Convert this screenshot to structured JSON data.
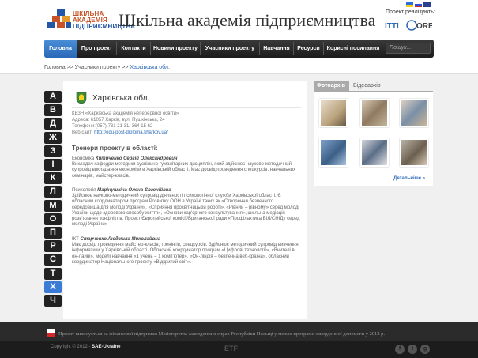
{
  "header": {
    "logo_lines": [
      "ШКІЛЬНА",
      "АКАДЕМІЯ",
      "ПІДПРИЄМНИЦТВА"
    ],
    "site_title": "Шкільна академія підприємництва",
    "project_label": "Проект реалізують:",
    "partner_logos": [
      "ITTI",
      "ORE"
    ],
    "colors": {
      "logo_orange": "#c8532a",
      "logo_blue": "#2356a5"
    }
  },
  "nav": {
    "items": [
      "Головна",
      "Про проект",
      "Контакти",
      "Новини проекту",
      "Учасники проекту",
      "Навчання",
      "Ресурси",
      "Корисні посилання"
    ],
    "active_index": 0,
    "search_placeholder": "Пошук..."
  },
  "breadcrumb": {
    "home": "Головна",
    "sep": ">>",
    "section": "Учасники проекту",
    "current": "Харківська обл."
  },
  "alphabet": [
    "А",
    "В",
    "Д",
    "Ж",
    "З",
    "І",
    "К",
    "Л",
    "М",
    "О",
    "П",
    "Р",
    "С",
    "Т",
    "Х",
    "Ч"
  ],
  "alphabet_active": "Х",
  "region": {
    "title": "Харківська обл.",
    "org": "КВЗН «Харківська академія неперервної освіти»",
    "address": "Адреса: 61057 Харків, вул. Пушкінська, 24",
    "phones": "Телефони:(057) 731 21 31, 364 15 62",
    "website_label": "Веб сайт:",
    "website": "http://edu-post-diploma.kharkov.ua/"
  },
  "trainers_heading": "Тренери проекту в області:",
  "trainers": [
    {
      "subject": "Економіка",
      "name": "Китиченко Сергій Олександрович",
      "bio": "Викладач кафедри методики суспільно-гуманітарних дисциплін, який здійснює науково-методичний супровід викладання економіки в Харківській області. Має досвід проведення спецкурсів, навчальних семінарів, майстер-класів."
    },
    {
      "subject": "Психологія",
      "name": "Марінушкіна Олена Євгенійвна",
      "bio": "Здійснює науково-методичний супровід діяльності психологічної служби Харківської області. Є обласним координатором програм Розвитку ООН в Україні таких як «Створення безпечного середовища для молоді України», «Сприяння просвітницькій роботі», «Рівний – рівному» серед молоді України щодо здорового способу життя», «Основи кар'єрного консультування», шкільна медіація розв'язання конфліктів, Проект Європейської комісії/Британської ради «Профілактика ВІЛ/СНІДу серед молоді України»"
    },
    {
      "subject": "ІКТ",
      "name": "Старченко Людмила Миколайвна",
      "bio": "Має досвід проведення майстер-класів, тренінгів, спецкурсів. Здійснює методичний супровід вивчення інформатики у Харківській області. Обласний координатор програм «Цифрові технології», «Вчителі в он-лайні», моделі навчання «1 учень – 1 комп'ютер», «Он-ліндія – безпечна веб-країна», обласний координатор Національного проекту «Відкритий світ»."
    }
  ],
  "right_tabs": [
    "Фотоархів",
    "Відеоархів"
  ],
  "more_link": "Детальніше »",
  "footer": {
    "note": "Проект виконується за фінансової підтримки Міністерства закордонних справ Республіки Польщі у межах програми закордонної допомоги у 2012 р.",
    "copyright_prefix": "Copyright © 2012 -",
    "copyright_org": "SAE-Ukraine",
    "etf": "ETF",
    "social_icons": [
      "f",
      "t",
      "g"
    ]
  }
}
